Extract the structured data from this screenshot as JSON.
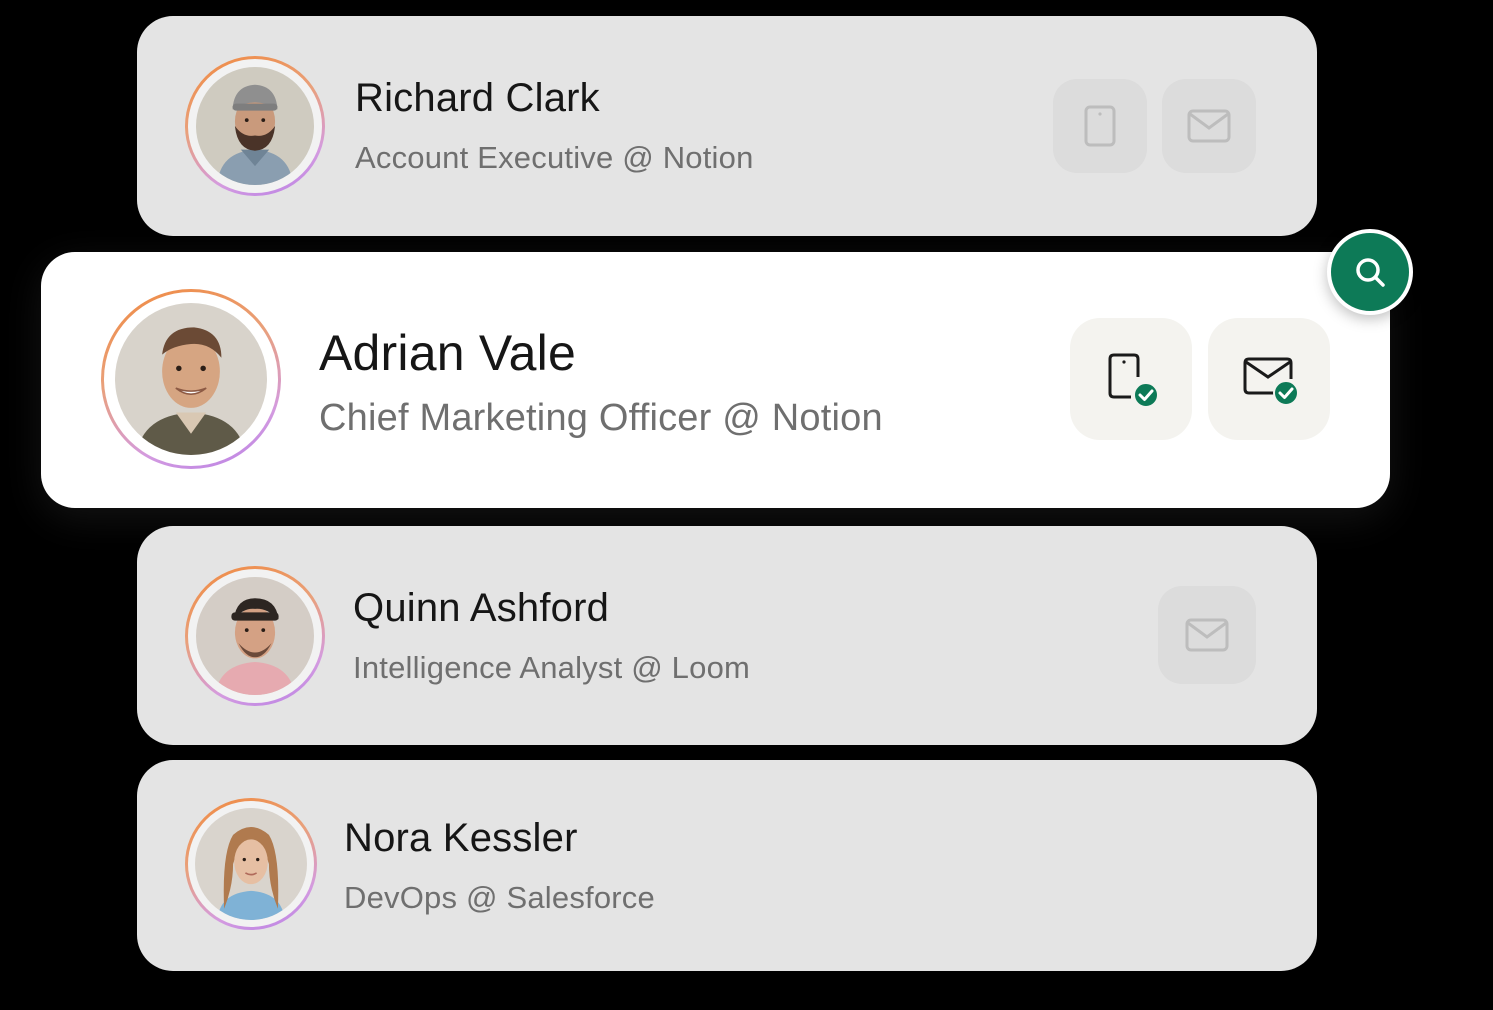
{
  "contacts": [
    {
      "name": "Richard Clark",
      "role": "Account Executive @ Notion",
      "actions": [
        "phone",
        "email"
      ],
      "phone_verified": false,
      "email_verified": false
    },
    {
      "name": "Adrian Vale",
      "role": "Chief Marketing Officer @ Notion",
      "actions": [
        "phone",
        "email"
      ],
      "phone_verified": true,
      "email_verified": true
    },
    {
      "name": "Quinn Ashford",
      "role": "Intelligence Analyst @ Loom",
      "actions": [
        "email"
      ],
      "phone_verified": false,
      "email_verified": false
    },
    {
      "name": "Nora Kessler",
      "role": "DevOps @ Salesforce",
      "actions": [],
      "phone_verified": false,
      "email_verified": false
    }
  ],
  "colors": {
    "background": "#000000",
    "card": "#e4e4e4",
    "card_active": "#ffffff",
    "accent": "#0d7a57",
    "ring_start": "#f0893f",
    "ring_end": "#b77fe6"
  },
  "icons": {
    "search": "search-icon",
    "phone": "phone-icon",
    "email": "mail-icon",
    "verified": "check-badge-icon"
  }
}
